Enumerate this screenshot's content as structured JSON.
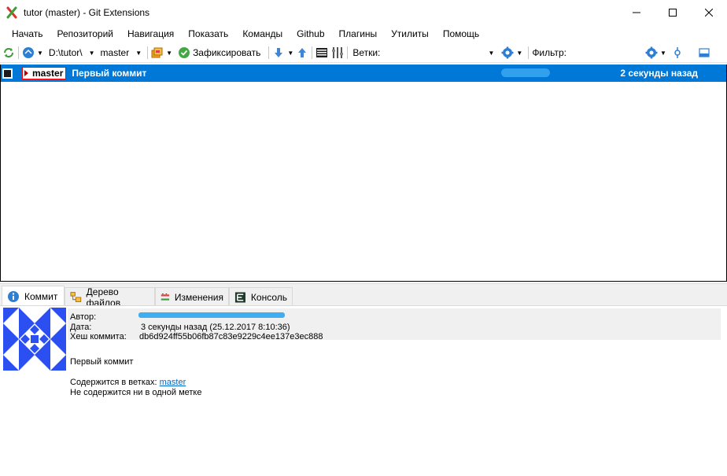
{
  "window": {
    "title": "tutor (master) - Git Extensions"
  },
  "menu": [
    "Начать",
    "Репозиторий",
    "Навигация",
    "Показать",
    "Команды",
    "Github",
    "Плагины",
    "Утилиты",
    "Помощь"
  ],
  "toolbar": {
    "repo_path": "D:\\tutor\\",
    "branch": "master",
    "commit_label": "Зафиксировать",
    "branches_label": "Ветки:",
    "filter_label": "Фильтр:"
  },
  "revision": {
    "branch_tag": "master",
    "message": "Первый коммит",
    "date": "2 секунды назад"
  },
  "tabs": [
    "Коммит",
    "Дерево файлов",
    "Изменения",
    "Консоль"
  ],
  "commit_info": {
    "author_label": "Автор:",
    "date_label": "Дата:",
    "date_value": "3 секунды назад (25.12.2017 8:10:36)",
    "hash_label": "Хеш коммита:",
    "hash_value": "db6d924ff55b06fb87c83e9229c4ee137e3ec888",
    "message": "Первый коммит",
    "contains_branches_label": "Содержится в ветках:",
    "contains_branch": "master",
    "no_tags_text": "Не содержится ни в одной метке"
  },
  "colors": {
    "selection": "#0078d7",
    "branch_tag_border": "#ff0000",
    "avatar": "#2b4ff0",
    "link": "#0066cc"
  }
}
